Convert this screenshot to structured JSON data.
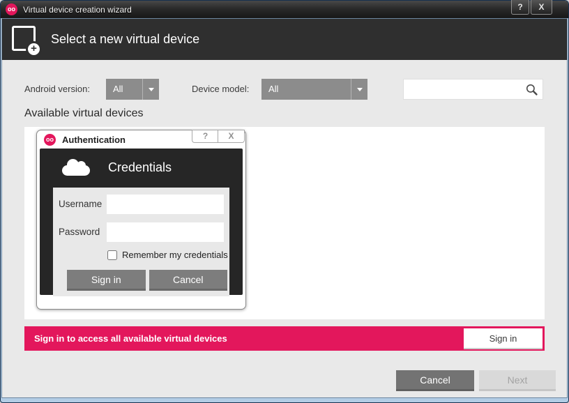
{
  "window": {
    "title": "Virtual device creation wizard",
    "logo_text": "oo",
    "help_label": "?",
    "close_label": "X"
  },
  "header": {
    "title": "Select a new virtual device",
    "add_glyph": "+"
  },
  "filters": {
    "android_version_label": "Android version:",
    "android_version_value": "All",
    "device_model_label": "Device model:",
    "device_model_value": "All",
    "search_value": "",
    "search_placeholder": ""
  },
  "devices": {
    "heading": "Available virtual devices"
  },
  "auth_dialog": {
    "title": "Authentication",
    "logo_text": "oo",
    "help_label": "?",
    "close_label": "X",
    "panel_title": "Credentials",
    "username_label": "Username",
    "username_value": "",
    "password_label": "Password",
    "password_value": "",
    "remember_label": "Remember my credentials",
    "remember_checked": false,
    "sign_in_label": "Sign in",
    "cancel_label": "Cancel"
  },
  "banner": {
    "message": "Sign in to access all available virtual devices",
    "sign_in_label": "Sign in",
    "color": "#e3175c"
  },
  "footer": {
    "cancel_label": "Cancel",
    "next_label": "Next",
    "next_enabled": false
  },
  "colors": {
    "brand_pink": "#e3175c",
    "header_dark": "#2f2f2f",
    "dialog_dark": "#262626",
    "content_bg": "#e9e9e9",
    "dropdown_gray": "#8c8c8c"
  }
}
